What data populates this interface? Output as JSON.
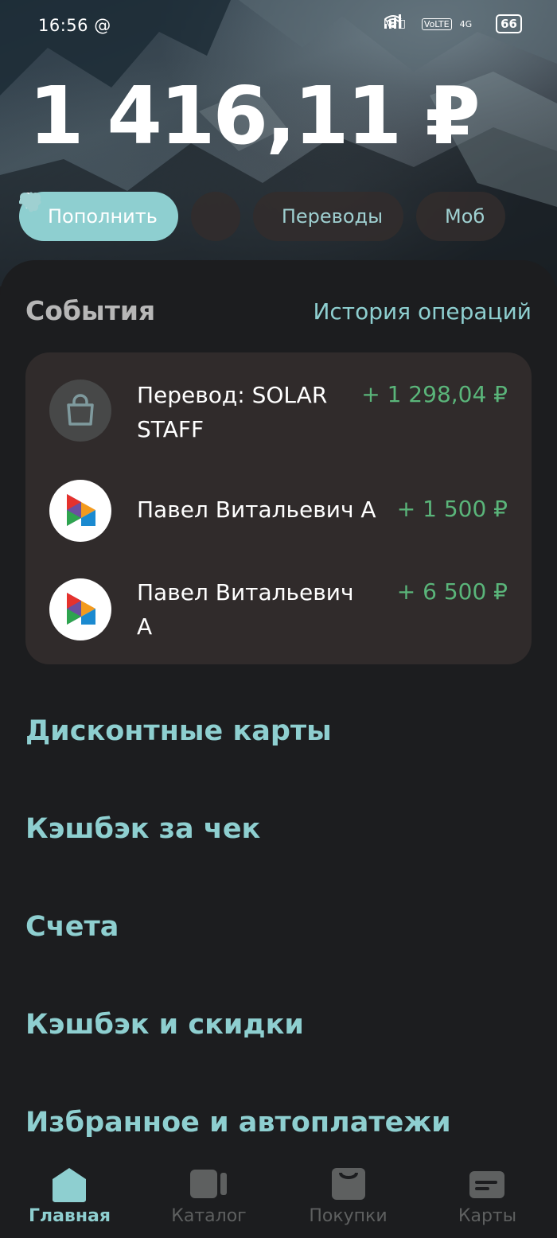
{
  "status_bar": {
    "time": "16:56",
    "at_sign": "@",
    "network": "4G",
    "battery": "66"
  },
  "balance": "1 416,11 ₽",
  "actions": [
    {
      "label": "Пополнить",
      "icon": "plus-icon"
    },
    {
      "label": "",
      "icon": "heart-icon"
    },
    {
      "label": "Переводы",
      "icon": "arrow-right-icon"
    },
    {
      "label": "Моб",
      "icon": "phone-icon"
    }
  ],
  "events": {
    "title": "События",
    "history_link": "История операций",
    "items": [
      {
        "name": "Перевод: SOLAR STAFF",
        "amount": "+ 1 298,04 ₽",
        "icon": "shopping-bag-icon"
      },
      {
        "name": "Павел Витальевич А",
        "amount": "+ 1 500 ₽",
        "icon": "sbp-logo-icon"
      },
      {
        "name": "Павел Витальевич А",
        "amount": "+ 6 500 ₽",
        "icon": "sbp-logo-icon"
      }
    ]
  },
  "menu": [
    "Дисконтные карты",
    "Кэшбэк за чек",
    "Счета",
    "Кэшбэк и скидки",
    "Избранное и автоплатежи"
  ],
  "tabbar": [
    {
      "label": "Главная",
      "icon": "home-icon",
      "active": true
    },
    {
      "label": "Каталог",
      "icon": "catalog-icon",
      "active": false
    },
    {
      "label": "Покупки",
      "icon": "shopping-bag-icon",
      "active": false
    },
    {
      "label": "Карты",
      "icon": "card-icon",
      "active": false
    }
  ],
  "colors": {
    "accent": "#8ecfd0",
    "positive": "#5ab57a",
    "card_bg": "#302b2b",
    "bg": "#1c1d1f"
  }
}
